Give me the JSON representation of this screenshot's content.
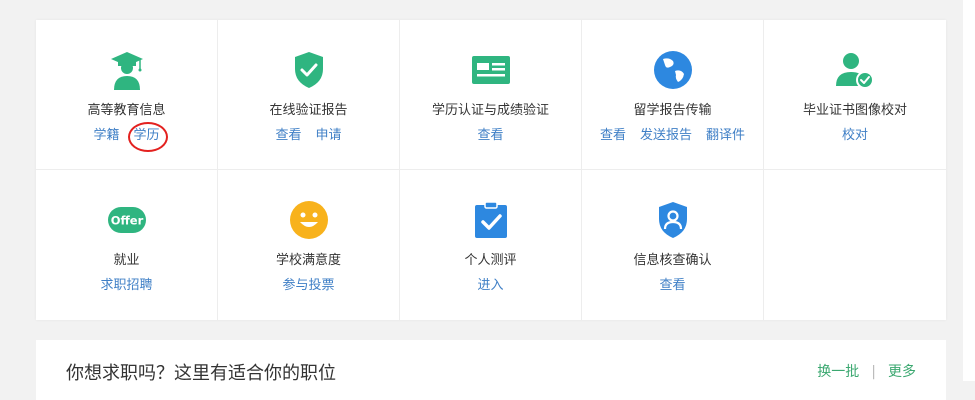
{
  "services": [
    {
      "icon": "graduation-cap-icon",
      "title": "高等教育信息",
      "links": [
        "学籍",
        "学历"
      ],
      "highlight": 1
    },
    {
      "icon": "shield-check-icon",
      "title": "在线验证报告",
      "links": [
        "查看",
        "申请"
      ]
    },
    {
      "icon": "id-card-icon",
      "title": "学历认证与成绩验证",
      "links": [
        "查看"
      ]
    },
    {
      "icon": "globe-icon",
      "title": "留学报告传输",
      "links": [
        "查看",
        "发送报告",
        "翻译件"
      ]
    },
    {
      "icon": "user-check-icon",
      "title": "毕业证书图像校对",
      "links": [
        "校对"
      ]
    },
    {
      "icon": "offer-badge-icon",
      "title": "就业",
      "links": [
        "求职招聘"
      ],
      "badge_text": "Offer"
    },
    {
      "icon": "smiley-face-icon",
      "title": "学校满意度",
      "links": [
        "参与投票"
      ]
    },
    {
      "icon": "clipboard-check-icon",
      "title": "个人测评",
      "links": [
        "进入"
      ]
    },
    {
      "icon": "shield-user-icon",
      "title": "信息核查确认",
      "links": [
        "查看"
      ]
    }
  ],
  "jobs": {
    "title": "你想求职吗？这里有适合你的职位",
    "refresh_label": "换一批",
    "separator": "|",
    "more_label": "更多"
  },
  "colors": {
    "green": "#2fb580",
    "blue": "#3f7fc6",
    "globe_blue": "#2d88e0",
    "smiley_yellow": "#f8b21c",
    "highlight_red": "#e3211f"
  }
}
